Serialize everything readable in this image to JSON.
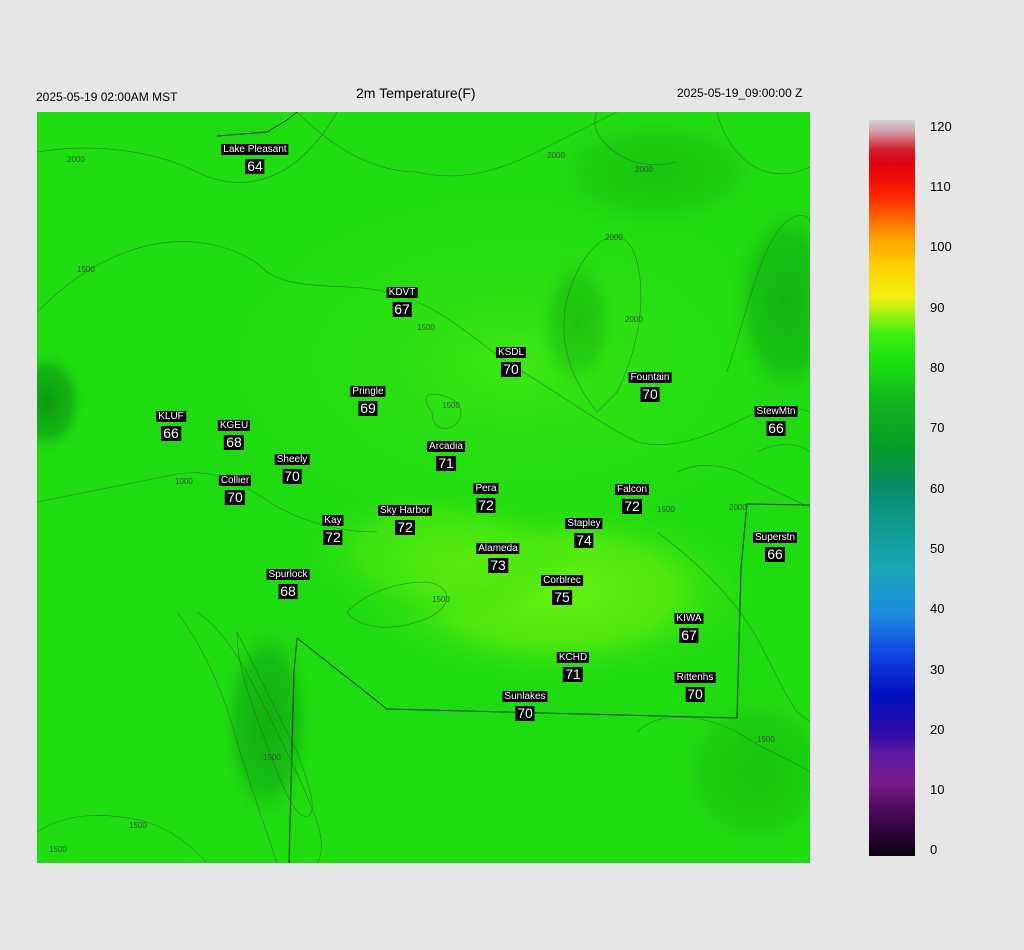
{
  "header": {
    "left": "2025-05-19 02:00AM MST",
    "title": "2m Temperature(F)",
    "right": "2025-05-19_09:00:00 Z"
  },
  "colorbar": {
    "ticks": [
      "120",
      "110",
      "100",
      "90",
      "80",
      "70",
      "60",
      "50",
      "40",
      "30",
      "20",
      "10",
      "0"
    ],
    "min": 0,
    "max": 120
  },
  "contour_labels": [
    "2000",
    "1500",
    "1000",
    "1500",
    "2000",
    "2000",
    "2000",
    "2000",
    "1500",
    "1500",
    "1500",
    "2000",
    "1500",
    "1500",
    "1500",
    "1500"
  ],
  "stations": [
    {
      "name": "Lake Pleasant",
      "value": "64"
    },
    {
      "name": "KDVT",
      "value": "67"
    },
    {
      "name": "KSDL",
      "value": "70"
    },
    {
      "name": "Fountain",
      "value": "70"
    },
    {
      "name": "Pringle",
      "value": "69"
    },
    {
      "name": "KLUF",
      "value": "66"
    },
    {
      "name": "KGEU",
      "value": "68"
    },
    {
      "name": "StewMtn",
      "value": "66"
    },
    {
      "name": "Arcadia",
      "value": "71"
    },
    {
      "name": "Sheely",
      "value": "70"
    },
    {
      "name": "Collier",
      "value": "70"
    },
    {
      "name": "Pera",
      "value": "72"
    },
    {
      "name": "Falcon",
      "value": "72"
    },
    {
      "name": "Sky Harbor",
      "value": "72"
    },
    {
      "name": "Kay",
      "value": "72"
    },
    {
      "name": "Stapley",
      "value": "74"
    },
    {
      "name": "Superstn",
      "value": "66"
    },
    {
      "name": "Alameda",
      "value": "73"
    },
    {
      "name": "Spurlock",
      "value": "68"
    },
    {
      "name": "Corblrec",
      "value": "75"
    },
    {
      "name": "KIWA",
      "value": "67"
    },
    {
      "name": "KCHD",
      "value": "71"
    },
    {
      "name": "Rittenhs",
      "value": "70"
    },
    {
      "name": "Sunlakes",
      "value": "70"
    }
  ]
}
